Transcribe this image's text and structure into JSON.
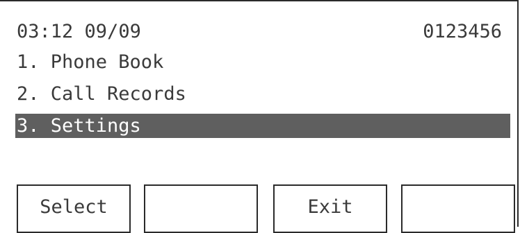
{
  "status": {
    "time": "03:12",
    "date": "09/09",
    "number": "0123456"
  },
  "menu": {
    "items": [
      {
        "label": "1. Phone Book"
      },
      {
        "label": "2. Call Records"
      },
      {
        "label": "3. Settings",
        "selected": true
      }
    ]
  },
  "softkeys": [
    {
      "label": "Select"
    },
    {
      "label": ""
    },
    {
      "label": "Exit"
    },
    {
      "label": ""
    }
  ],
  "colors": {
    "highlight": "#5f5f5f",
    "text": "#3a3a3a",
    "border": "#2a2a2a",
    "background": "#ffffff"
  }
}
